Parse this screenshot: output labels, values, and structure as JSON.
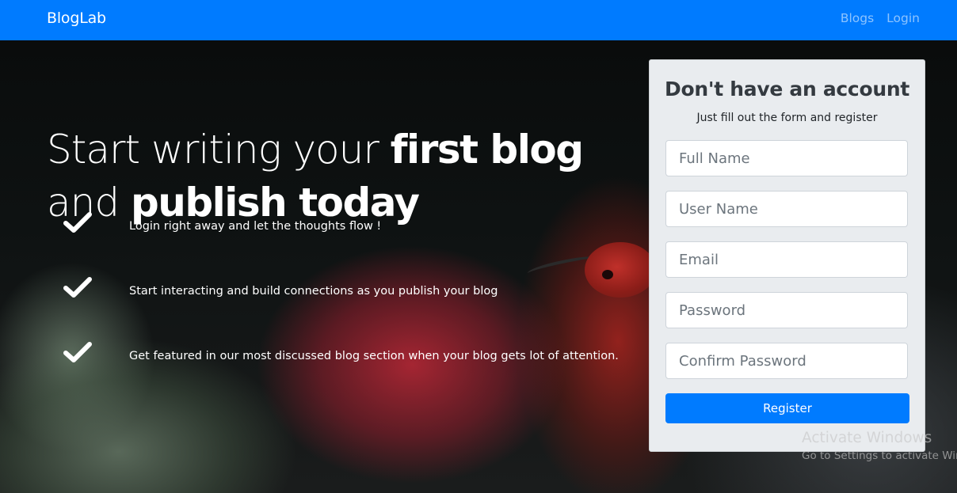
{
  "navbar": {
    "brand": "BlogLab",
    "links": [
      "Blogs",
      "Login"
    ]
  },
  "hero": {
    "headline": {
      "line1_light": "Start writing your ",
      "line1_bold": "first blog",
      "line2_light": "and ",
      "line2_bold": "publish today"
    },
    "features": [
      {
        "icon": "check-icon",
        "text": "Login right away and let the thoughts flow !"
      },
      {
        "icon": "check-icon",
        "text": "Start interacting and build connections as you publish your blog"
      },
      {
        "icon": "check-icon",
        "text": "Get featured in our most discussed blog section when your blog gets lot of attention."
      }
    ]
  },
  "register_card": {
    "title": "Don't have an account",
    "subtitle": "Just fill out the form and register",
    "fields": {
      "full_name": {
        "value": "",
        "placeholder": "Full Name"
      },
      "user_name": {
        "value": "",
        "placeholder": "User Name"
      },
      "email": {
        "value": "",
        "placeholder": "Email"
      },
      "password": {
        "value": "",
        "placeholder": "Password"
      },
      "confirm_password": {
        "value": "",
        "placeholder": "Confirm Password"
      }
    },
    "button_label": "Register"
  },
  "watermark": {
    "line1": "Activate Windows",
    "line2": "Go to Settings to activate Windows."
  },
  "colors": {
    "primary": "#007bff",
    "card_bg": "#e9ecef",
    "nav_link": "rgba(255,255,255,0.55)"
  }
}
